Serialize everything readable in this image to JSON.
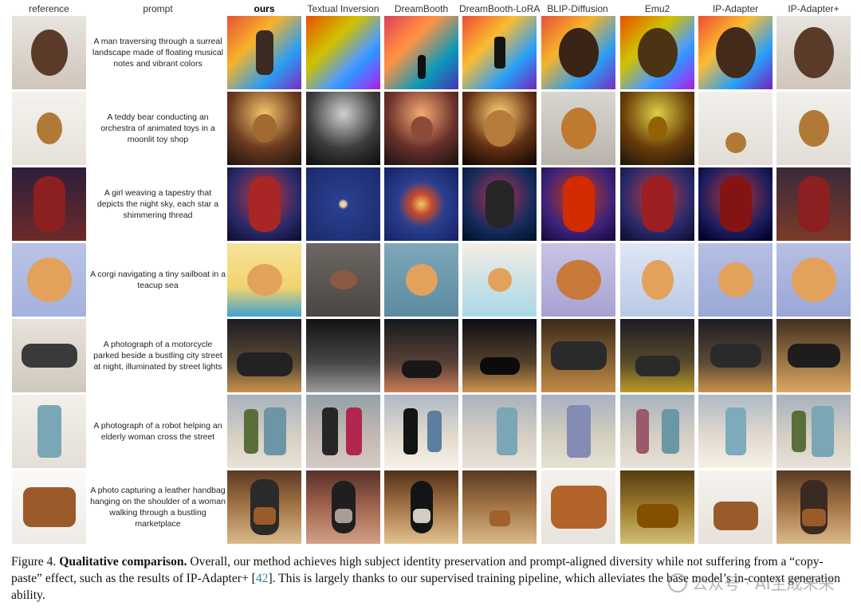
{
  "columns": {
    "reference": "reference",
    "prompt": "prompt",
    "ours": "ours",
    "textual_inversion": "Textual Inversion",
    "dreambooth": "DreamBooth",
    "dreambooth_lora": "DreamBooth-LoRA",
    "blip_diffusion": "BLIP-Diffusion",
    "emu2": "Emu2",
    "ip_adapter": "IP-Adapter",
    "ip_adapter_plus": "IP-Adapter+"
  },
  "rows": [
    {
      "prompt": "A man traversing through a surreal landscape made of floating musical notes and vibrant colors"
    },
    {
      "prompt": "A teddy bear conducting an orchestra of animated toys in a moonlit toy shop"
    },
    {
      "prompt": "A girl weaving a tapestry that depicts the night sky, each star a shimmering thread"
    },
    {
      "prompt": "A corgi navigating a tiny sailboat in a teacup sea"
    },
    {
      "prompt": "A photograph of a motorcycle parked beside a bustling city street at night, illuminated by street lights"
    },
    {
      "prompt": "A photograph of a robot helping an elderly woman cross the street"
    },
    {
      "prompt": "A photo capturing a leather handbag hanging on the shoulder of a woman walking through a bustling marketplace"
    }
  ],
  "caption": {
    "label": "Figure 4.",
    "title": "Qualitative comparison.",
    "text_before_cite": "Overall, our method achieves high subject identity preservation and prompt-aligned diversity while not suffering from a “copy-paste” effect, such as the results of IP-Adapter+ [",
    "cite": "42",
    "text_after_cite": "]. This is largely thanks to our supervised training pipeline, which alleviates the base model’s in-context generation ability."
  },
  "watermark": "公众号 · AI生成未来",
  "colors": {
    "citation": "#3b7ea1",
    "background": "#ffffff"
  }
}
